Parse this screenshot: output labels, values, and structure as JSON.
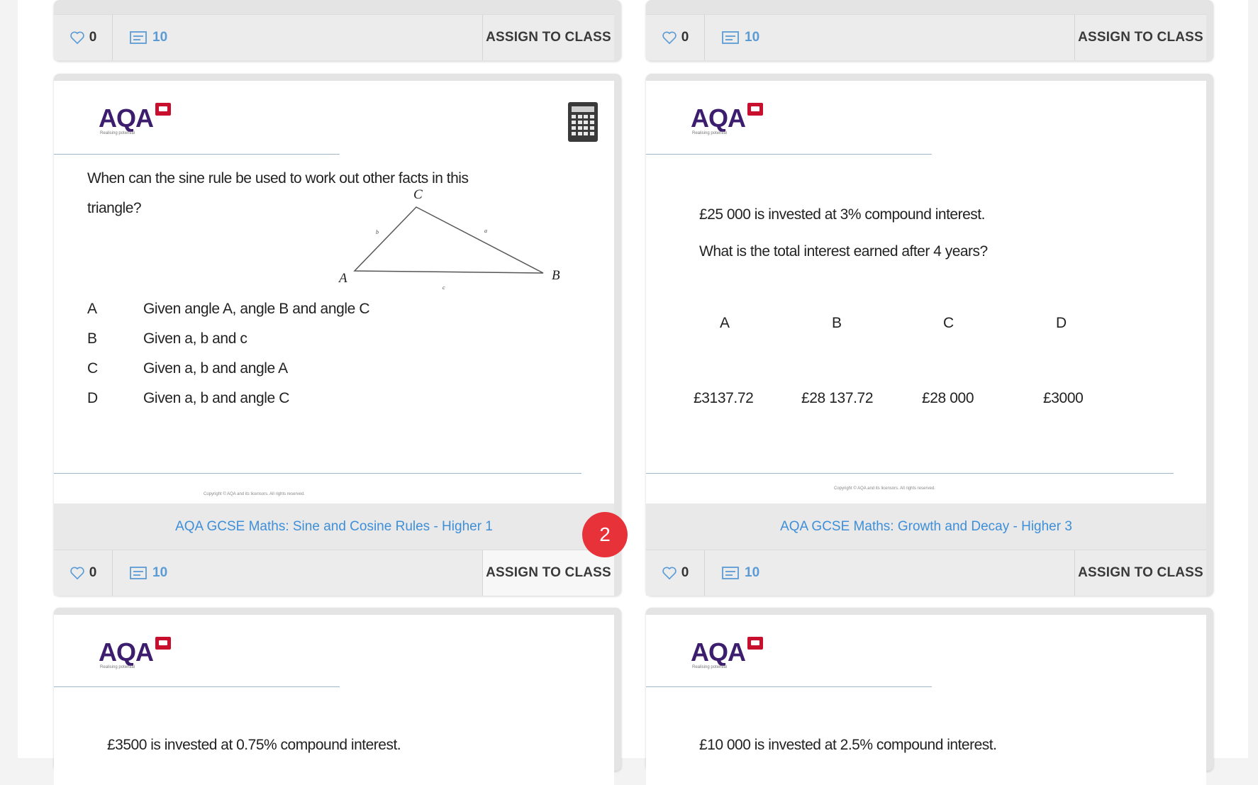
{
  "top_cards": [
    {
      "likes": "0",
      "questions": "10",
      "assign_label": "ASSIGN TO CLASS"
    },
    {
      "likes": "0",
      "questions": "10",
      "assign_label": "ASSIGN TO CLASS"
    }
  ],
  "cards": [
    {
      "logo": "AQA",
      "logo_tagline": "Realising potential",
      "question_line1": "When can the sine rule be used to work out other facts in this",
      "question_line2": "triangle?",
      "triangle": {
        "vertex_a": "A",
        "vertex_b": "B",
        "vertex_c": "C",
        "side_a": "a",
        "side_b": "b",
        "side_c": "c"
      },
      "options": [
        {
          "letter": "A",
          "text": "Given angle A, angle B and angle C"
        },
        {
          "letter": "B",
          "text": "Given a, b and c"
        },
        {
          "letter": "C",
          "text": "Given a, b and angle A"
        },
        {
          "letter": "D",
          "text": "Given a, b and angle C"
        }
      ],
      "copyright": "Copyright © AQA and its licensors. All rights reserved.",
      "title": "AQA GCSE Maths: Sine and Cosine Rules - Higher 1",
      "likes": "0",
      "questions": "10",
      "assign_label": "ASSIGN TO CLASS",
      "badge": "2"
    },
    {
      "logo": "AQA",
      "logo_tagline": "Realising potential",
      "question_line1": "£25 000 is invested at 3% compound interest.",
      "question_line2": "What is the total interest earned after 4 years?",
      "option_letters": [
        "A",
        "B",
        "C",
        "D"
      ],
      "option_values": [
        "£3137.72",
        "£28 137.72",
        "£28 000",
        "£3000"
      ],
      "copyright": "Copyright © AQA and its licensors. All rights reserved.",
      "title": "AQA GCSE Maths: Growth and Decay - Higher 3",
      "likes": "0",
      "questions": "10",
      "assign_label": "ASSIGN TO CLASS"
    }
  ],
  "bottom_cards": [
    {
      "logo": "AQA",
      "logo_tagline": "Realising potential",
      "question_line1": "£3500 is invested at 0.75% compound interest."
    },
    {
      "logo": "AQA",
      "logo_tagline": "Realising potential",
      "question_line1": "£10 000 is invested at 2.5% compound interest."
    }
  ],
  "colors": {
    "accent_blue": "#3e8fd8",
    "badge_red": "#e8323a",
    "aqa_purple": "#3c1d6e",
    "aqa_red": "#c8102e"
  },
  "icons": {
    "likes": "heart-icon",
    "questions": "question-list-icon",
    "calculator": "calculator-icon"
  }
}
